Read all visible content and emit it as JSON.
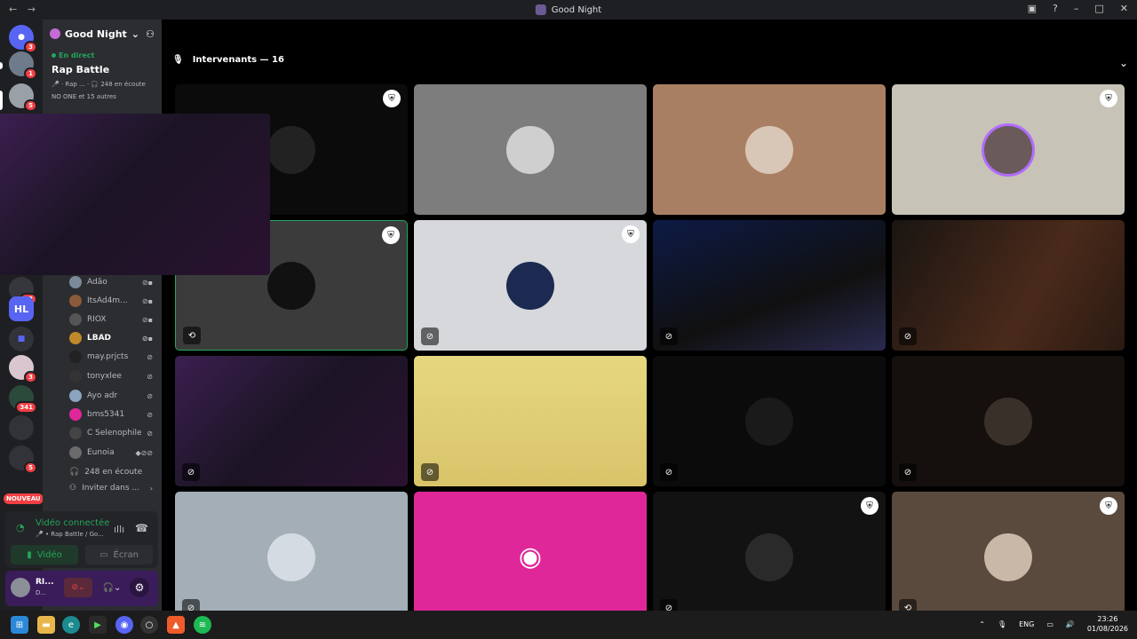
{
  "window": {
    "title": "Good Night"
  },
  "rail": {
    "badges": [
      "3",
      "1",
      "5",
      "22",
      "3",
      "341",
      "5"
    ],
    "new_label": "NOUVEAU",
    "hl_label": "HL"
  },
  "guild": {
    "name": "Good Night"
  },
  "live": {
    "tag": "En direct",
    "stage": "Rap Battle",
    "meta": "🎤 · Rap ...  ·  🎧 248 en écoute",
    "others": "NO ONE et 15 autres"
  },
  "members": [
    {
      "name": "Adão"
    },
    {
      "name": "ItsAd4m..."
    },
    {
      "name": "RIOX"
    },
    {
      "name": "LBAD"
    },
    {
      "name": "may.prjcts"
    },
    {
      "name": "tonyxlee"
    },
    {
      "name": "Ayo adr"
    },
    {
      "name": "bms5341"
    },
    {
      "name": "C Selenophile"
    },
    {
      "name": "Eunoia"
    }
  ],
  "listeners": "248 en écoute",
  "invite": "Inviter dans ...",
  "voice": {
    "status": "Vidéo connectée",
    "sub": "🎤 • Rap Battle / Go...",
    "video_label": "Vidéo",
    "screen_label": "Écran"
  },
  "user": {
    "name": "RI...",
    "sub": "D..."
  },
  "main": {
    "header": "Intervenants — 16"
  },
  "taskbar": {
    "lang": "ENG",
    "time": "23:26",
    "date": "01/08/2026"
  },
  "tiles_colors": {
    "dark": "#0b0b0b",
    "grey": "#7d7d7d",
    "tan": "#a97f63",
    "beige": "#c7c3b6",
    "mid": "#3b3b3b",
    "light": "#d6d8dc",
    "pink": "#e0279a",
    "slate": "#a3aeb7",
    "brown": "#5a4a3e"
  }
}
